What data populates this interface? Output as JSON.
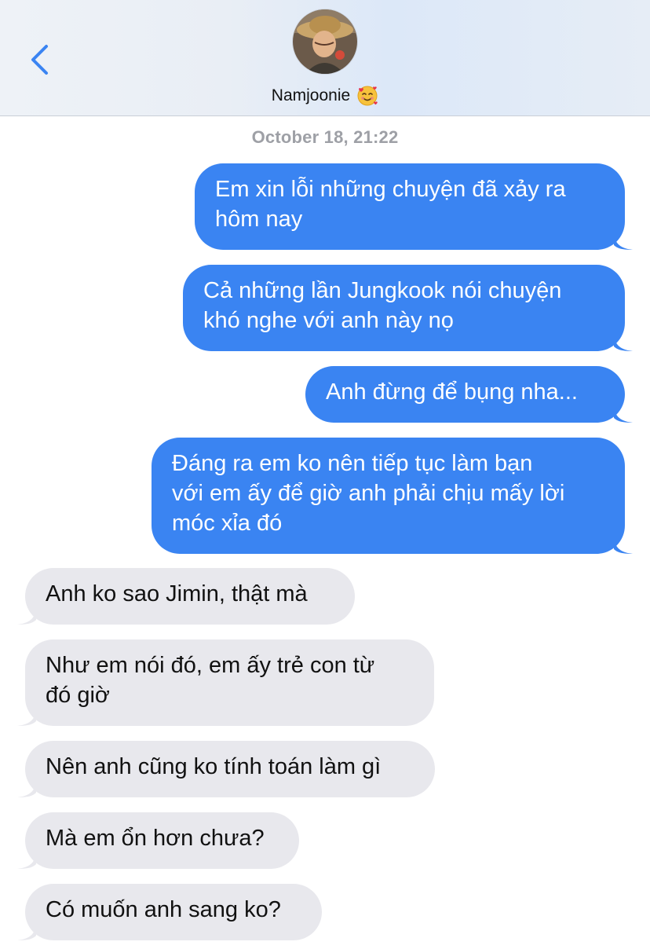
{
  "header": {
    "back_icon": "chevron-left-icon",
    "contact_name": "Namjoonie",
    "contact_emoji": "smiling-face-with-hearts",
    "accent_color": "#3a84f2"
  },
  "conversation": {
    "timestamp": "October 18, 21:22",
    "messages": [
      {
        "direction": "outgoing",
        "text": "Em xin lỗi những chuyện đã xảy ra\nhôm nay"
      },
      {
        "direction": "outgoing",
        "text": "Cả những lần Jungkook nói chuyện\nkhó nghe với anh này nọ"
      },
      {
        "direction": "outgoing",
        "text": "Anh đừng để bụng nha..."
      },
      {
        "direction": "outgoing",
        "text": "Đáng ra em ko nên tiếp tục làm bạn\nvới em ấy để giờ anh phải chịu mấy lời\nmóc xỉa đó"
      },
      {
        "direction": "incoming",
        "text": "Anh ko sao Jimin, thật mà"
      },
      {
        "direction": "incoming",
        "text": "Như em nói đó, em ấy trẻ con từ\nđó giờ"
      },
      {
        "direction": "incoming",
        "text": "Nên anh cũng ko tính toán làm gì"
      },
      {
        "direction": "incoming",
        "text": "Mà em ổn hơn chưa?"
      },
      {
        "direction": "incoming",
        "text": "Có muốn anh sang ko?"
      }
    ]
  }
}
